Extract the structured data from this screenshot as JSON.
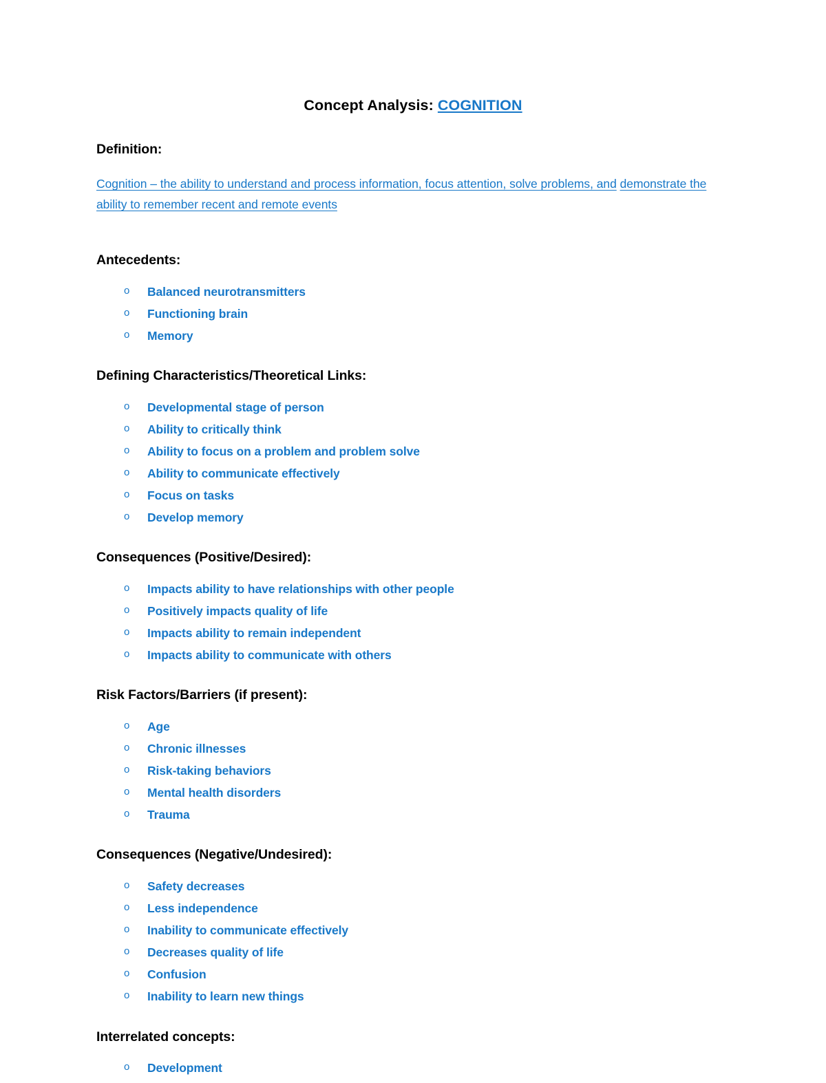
{
  "document": {
    "title_prefix": "Concept Analysis: ",
    "title_link": "COGNITION",
    "bullet_marker": "o",
    "accent_color": "#1878C8",
    "text_color": "#000000"
  },
  "definition": {
    "heading": "Definition:",
    "line1": "Cognition – the ability to understand and process information, focus attention, solve problems, and",
    "line2": "demonstrate the ability to remember recent and remote events"
  },
  "sections": [
    {
      "heading": "Antecedents:",
      "items": [
        "Balanced neurotransmitters",
        "Functioning brain",
        "Memory"
      ]
    },
    {
      "heading": "Defining Characteristics/Theoretical Links:",
      "items": [
        "Developmental stage of person",
        "Ability to critically think",
        "Ability to focus on a problem and problem solve",
        "Ability to communicate effectively",
        "Focus on tasks",
        "Develop memory"
      ]
    },
    {
      "heading": "Consequences (Positive/Desired):",
      "items": [
        "Impacts ability to have relationships with other people",
        "Positively impacts quality of life",
        "Impacts ability to remain independent",
        "Impacts ability to communicate with others"
      ]
    },
    {
      "heading": "Risk Factors/Barriers (if present):",
      "items": [
        "Age",
        "Chronic illnesses",
        "Risk-taking behaviors",
        "Mental health disorders",
        "Trauma"
      ]
    },
    {
      "heading": "Consequences (Negative/Undesired):",
      "items": [
        "Safety decreases",
        "Less independence",
        "Inability to communicate effectively",
        "Decreases quality of life",
        "Confusion",
        "Inability to learn new things"
      ]
    },
    {
      "heading": "Interrelated concepts:",
      "items": [
        "Development"
      ]
    }
  ]
}
